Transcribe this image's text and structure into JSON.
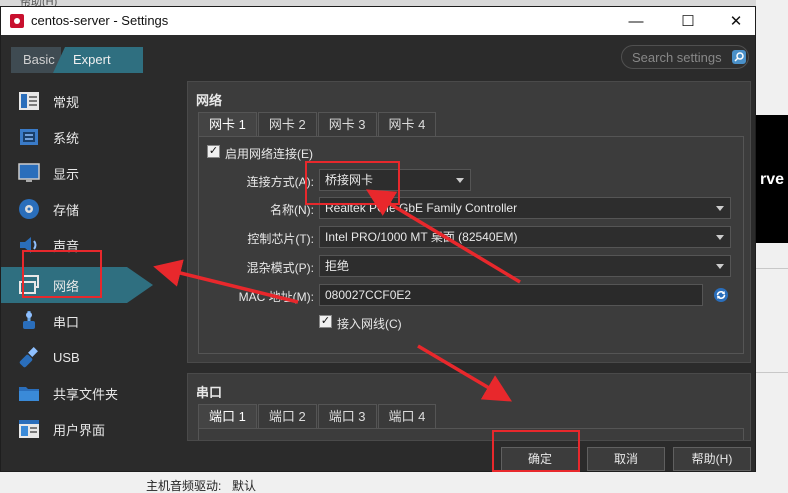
{
  "background": {
    "top_menu": "帮助(H)",
    "right_panel_text": "rve",
    "status_label": "主机音频驱动:",
    "status_value": "默认"
  },
  "window": {
    "title": "centos-server - Settings",
    "buttons": {
      "minimize": "—",
      "maximize": "☐",
      "close": "✕"
    }
  },
  "mode": {
    "basic": "Basic",
    "expert": "Expert"
  },
  "search": {
    "placeholder": "Search settings"
  },
  "sidebar": {
    "items": [
      {
        "label": "常规",
        "icon": "general-icon"
      },
      {
        "label": "系统",
        "icon": "system-icon"
      },
      {
        "label": "显示",
        "icon": "display-icon"
      },
      {
        "label": "存储",
        "icon": "storage-icon"
      },
      {
        "label": "声音",
        "icon": "audio-icon"
      },
      {
        "label": "网络",
        "icon": "network-icon",
        "active": true
      },
      {
        "label": "串口",
        "icon": "serial-port-icon"
      },
      {
        "label": "USB",
        "icon": "usb-icon"
      },
      {
        "label": "共享文件夹",
        "icon": "shared-folder-icon"
      },
      {
        "label": "用户界面",
        "icon": "user-interface-icon"
      }
    ]
  },
  "network": {
    "title": "网络",
    "tabs": [
      "网卡 1",
      "网卡 2",
      "网卡 3",
      "网卡 4"
    ],
    "enable_label": "启用网络连接(E)",
    "enable_checked": true,
    "fields": {
      "attached_label": "连接方式(A):",
      "attached_value": "桥接网卡",
      "name_label": "名称(N):",
      "name_value": "Realtek PCIe GbE Family Controller",
      "adapter_label": "控制芯片(T):",
      "adapter_value": "Intel PRO/1000 MT 桌面 (82540EM)",
      "promisc_label": "混杂模式(P):",
      "promisc_value": "拒绝",
      "mac_label": "MAC 地址(M):",
      "mac_value": "080027CCF0E2"
    },
    "cable_label": "接入网线(C)",
    "cable_checked": true
  },
  "serial": {
    "title": "串口",
    "tabs": [
      "端口 1",
      "端口 2",
      "端口 3",
      "端口 4"
    ]
  },
  "footer": {
    "ok": "确定",
    "cancel": "取消",
    "help": "帮助(H)"
  },
  "colors": {
    "accent": "#2f6f80",
    "annotation": "#e8282c",
    "window_bg": "#2b2b2b",
    "panel_bg": "#3c3c3c"
  }
}
